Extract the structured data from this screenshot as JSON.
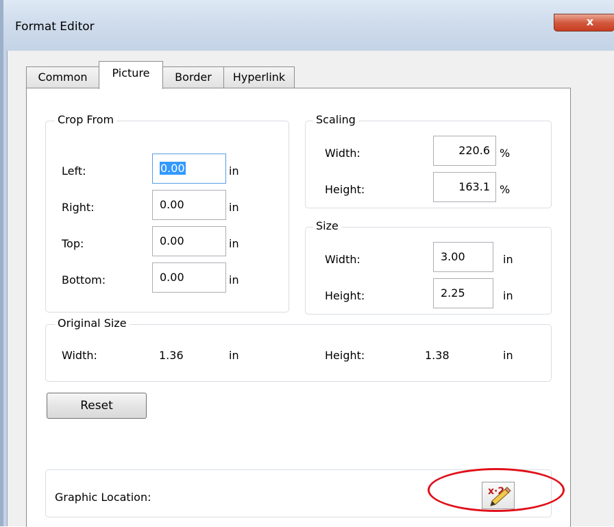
{
  "window": {
    "title": "Format Editor",
    "close_glyph": "x"
  },
  "tabs": [
    {
      "label": "Common"
    },
    {
      "label": "Picture",
      "active": true
    },
    {
      "label": "Border"
    },
    {
      "label": "Hyperlink"
    }
  ],
  "crop": {
    "title": "Crop From",
    "rows": [
      {
        "label": "Left:",
        "value": "0.00",
        "unit": "in"
      },
      {
        "label": "Right:",
        "value": "0.00",
        "unit": "in"
      },
      {
        "label": "Top:",
        "value": "0.00",
        "unit": "in"
      },
      {
        "label": "Bottom:",
        "value": "0.00",
        "unit": "in"
      }
    ]
  },
  "scaling": {
    "title": "Scaling",
    "rows": [
      {
        "label": "Width:",
        "value": "220.6",
        "unit": "%"
      },
      {
        "label": "Height:",
        "value": "163.1",
        "unit": "%"
      }
    ]
  },
  "size": {
    "title": "Size",
    "rows": [
      {
        "label": "Width:",
        "value": "3.00",
        "unit": "in"
      },
      {
        "label": "Height:",
        "value": "2.25",
        "unit": "in"
      }
    ]
  },
  "original": {
    "title": "Original Size",
    "width_label": "Width:",
    "width_value": "1.36",
    "width_unit": "in",
    "height_label": "Height:",
    "height_value": "1.38",
    "height_unit": "in"
  },
  "reset_label": "Reset",
  "graphic": {
    "label": "Graphic Location:",
    "button_icon": "formula-edit-icon",
    "button_text": "x·2"
  },
  "colors": {
    "highlight": "#e0101a",
    "selection": "#3399ff",
    "close_button": "#c73c20"
  }
}
